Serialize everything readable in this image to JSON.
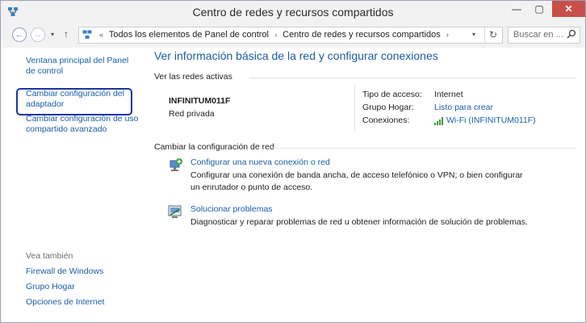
{
  "window": {
    "title": "Centro de redes y recursos compartidos",
    "controls": {
      "minimize": "—",
      "maximize": "▢",
      "close": "✕"
    }
  },
  "navbar": {
    "back": "←",
    "forward": "→",
    "recent": "▾",
    "up": "↑",
    "breadcrumb": {
      "overflow": "«",
      "items": [
        "Todos los elementos de Panel de control",
        "Centro de redes y recursos compartidos"
      ],
      "separator": "›"
    },
    "dropdown": "▾",
    "refresh": "↻",
    "search_placeholder": "Buscar en ..."
  },
  "sidebar": {
    "links": [
      "Ventana principal del Panel de control",
      "Cambiar configuración del adaptador",
      "Cambiar configuración de uso compartido avanzado"
    ],
    "see_also_label": "Vea también",
    "see_also": [
      "Firewall de Windows",
      "Grupo Hogar",
      "Opciones de Internet"
    ]
  },
  "main": {
    "heading": "Ver información básica de la red y configurar conexiones",
    "active_networks_label": "Ver las redes activas",
    "network": {
      "name": "INFINITUM011F",
      "type": "Red privada",
      "access_type_label": "Tipo de acceso:",
      "access_type_value": "Internet",
      "homegroup_label": "Grupo Hogar:",
      "homegroup_value": "Listo para crear",
      "connections_label": "Conexiones:",
      "connections_value": "Wi-Fi (INFINITUM011F)"
    },
    "change_settings_label": "Cambiar la configuración de red",
    "tasks": [
      {
        "title": "Configurar una nueva conexión o red",
        "description": "Configurar una conexión de banda ancha, de acceso telefónico o VPN; o bien configurar un enrutador o punto de acceso."
      },
      {
        "title": "Solucionar problemas",
        "description": "Diagnosticar y reparar problemas de red u obtener información de solución de problemas."
      }
    ]
  },
  "colors": {
    "link": "#1a5ea8",
    "heading": "#1e5aa0",
    "close_button": "#c7504a",
    "highlight": "#1a35a3"
  }
}
